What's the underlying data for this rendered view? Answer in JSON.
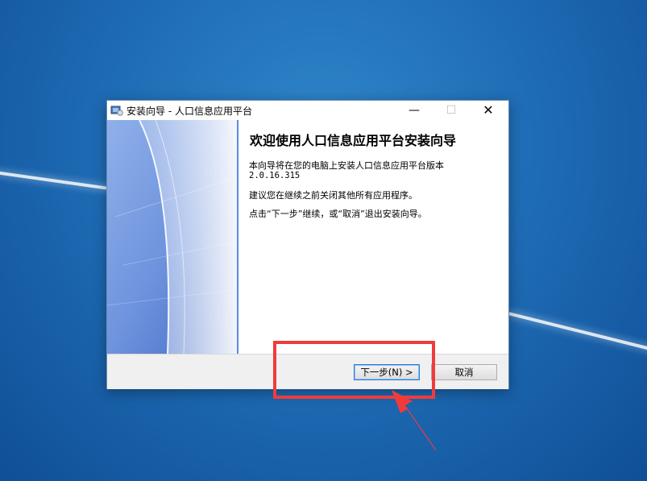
{
  "window": {
    "title": "安装向导 - 人口信息应用平台",
    "controls": {
      "minimize": "—",
      "maximize": "☐",
      "close": "✕"
    }
  },
  "content": {
    "heading": "欢迎使用人口信息应用平台安装向导",
    "line1": "本向导将在您的电脑上安装人口信息应用平台版本",
    "version": "2.0.16.315",
    "line2": "建议您在继续之前关闭其他所有应用程序。",
    "line3": "点击“下一步”继续，或“取消”退出安装向导。"
  },
  "buttons": {
    "next": "下一步(N) >",
    "cancel": "取消"
  },
  "colors": {
    "desktop": "#1f6db6",
    "annotation": "#f03b3b",
    "focus_border": "#2b79d6"
  }
}
